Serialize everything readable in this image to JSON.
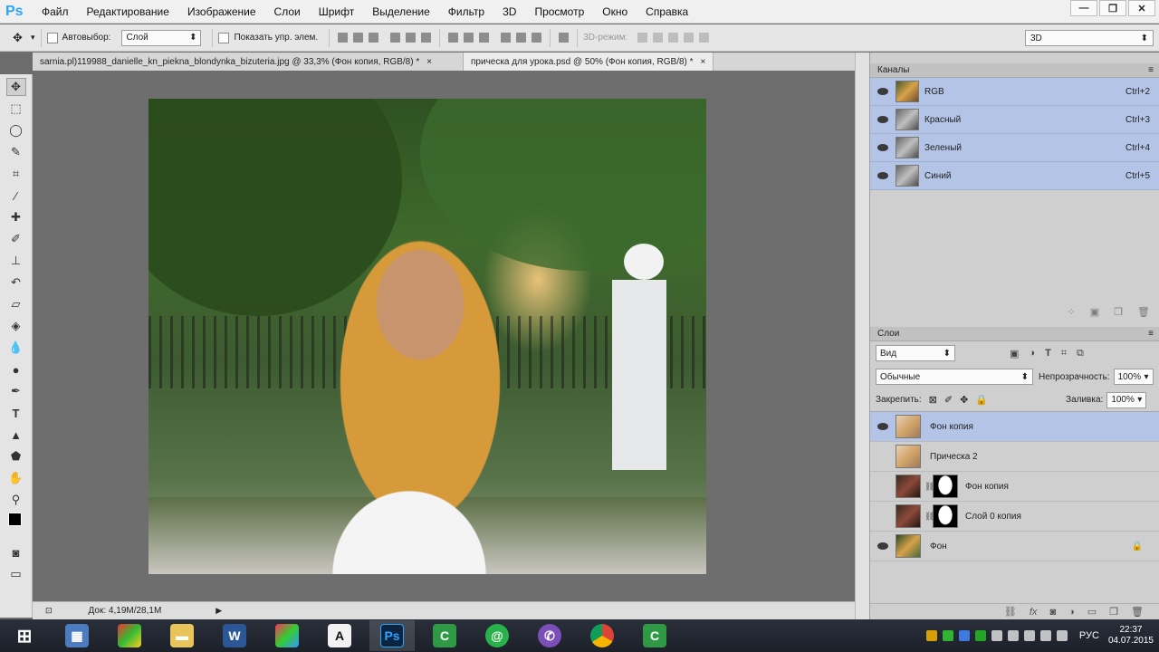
{
  "app": {
    "logo": "Ps"
  },
  "menu": [
    "Файл",
    "Редактирование",
    "Изображение",
    "Слои",
    "Шрифт",
    "Выделение",
    "Фильтр",
    "3D",
    "Просмотр",
    "Окно",
    "Справка"
  ],
  "window_controls": {
    "minimize": "—",
    "maximize": "❐",
    "close": "✕"
  },
  "options": {
    "autoselect_label": "Автовыбор:",
    "autoselect_value": "Слой",
    "show_controls_label": "Показать упр. элем.",
    "mode_3d_label": "3D-режим:",
    "workspace_value": "3D"
  },
  "tabs": [
    {
      "label": "sarnia.pl)119988_danielle_kn_piekna_blondynka_bizuteria.jpg @ 33,3% (Фон копия, RGB/8) *",
      "close": "×"
    },
    {
      "label": "прическа для урока.psd @ 50% (Фон копия, RGB/8) *",
      "close": "×"
    }
  ],
  "status": {
    "doc": "Док: 4,19M/28,1M"
  },
  "channels_panel": {
    "title": "Каналы",
    "channels": [
      {
        "name": "RGB",
        "shortcut": "Ctrl+2"
      },
      {
        "name": "Красный",
        "shortcut": "Ctrl+3"
      },
      {
        "name": "Зеленый",
        "shortcut": "Ctrl+4"
      },
      {
        "name": "Синий",
        "shortcut": "Ctrl+5"
      }
    ]
  },
  "layers_panel": {
    "title": "Слои",
    "filter_value": "Вид",
    "blend_mode": "Обычные",
    "opacity_label": "Непрозрачность:",
    "opacity_value": "100%",
    "lock_label": "Закрепить:",
    "fill_label": "Заливка:",
    "fill_value": "100%",
    "layers": [
      {
        "name": "Фон копия",
        "visible": true,
        "active": true
      },
      {
        "name": "Прическа 2",
        "visible": false,
        "active": false
      },
      {
        "name": "Фон копия",
        "visible": false,
        "active": false
      },
      {
        "name": "Слой 0 копия",
        "visible": false,
        "active": false
      },
      {
        "name": "Фон",
        "visible": true,
        "active": false,
        "locked": true
      }
    ]
  },
  "taskbar": {
    "lang": "РУС",
    "time": "22:37",
    "date": "04.07.2015"
  }
}
